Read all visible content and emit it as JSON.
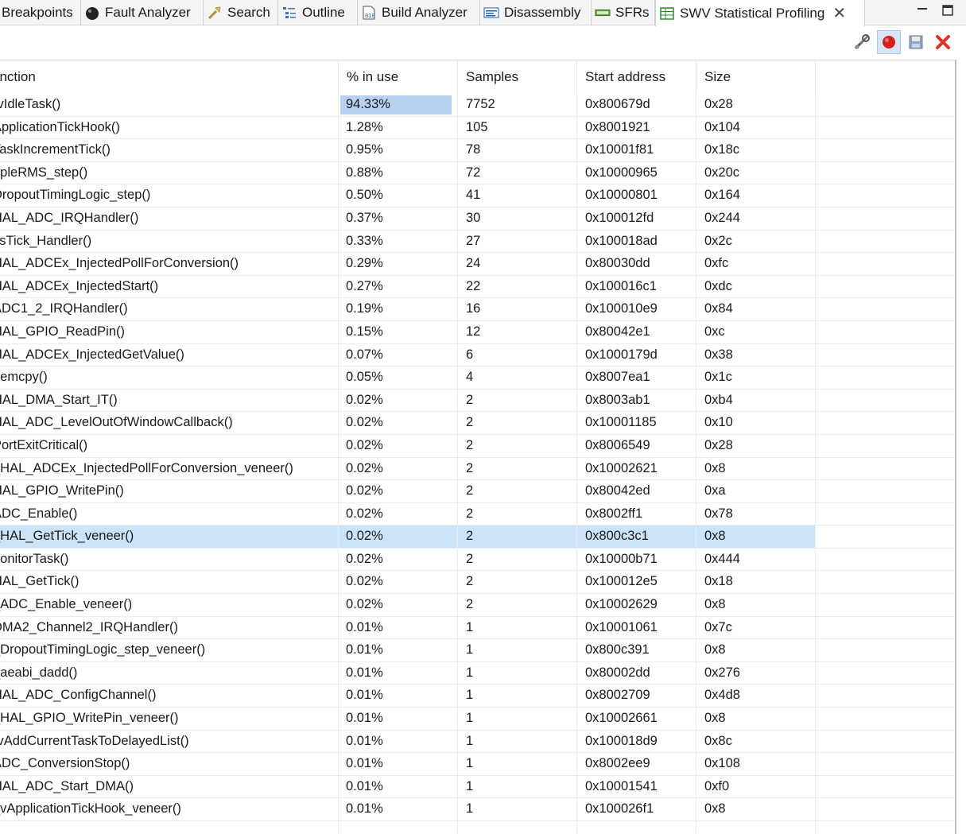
{
  "tabs": [
    {
      "label": "Breakpoints",
      "icon": "breakpoints-icon"
    },
    {
      "label": "Fault Analyzer",
      "icon": "fault-analyzer-icon"
    },
    {
      "label": "Search",
      "icon": "search-icon"
    },
    {
      "label": "Outline",
      "icon": "outline-icon"
    },
    {
      "label": "Build Analyzer",
      "icon": "build-analyzer-icon"
    },
    {
      "label": "Disassembly",
      "icon": "disassembly-icon"
    },
    {
      "label": "SFRs",
      "icon": "sfr-icon"
    },
    {
      "label": "SWV Statistical Profiling",
      "icon": "table-icon",
      "active": true
    }
  ],
  "window_controls": [
    "minimize-icon",
    "maximize-icon"
  ],
  "toolbar": [
    "configure-trace-icon",
    "record-icon",
    "save-icon",
    "remove-icon"
  ],
  "colors": {
    "selected_row": "#cce4f7",
    "usage_bar": "#b7d1ef",
    "record_red": "#d41f1f",
    "remove_red": "#e0302b"
  },
  "table": {
    "columns": [
      "unction",
      "% in use",
      "Samples",
      "Start address",
      "Size"
    ],
    "selected_row_index": 19,
    "rows": [
      {
        "function": "rvIdleTask()",
        "pct": "94.33%",
        "usage": 0.9433,
        "samples": "7752",
        "start": "0x800679d",
        "size": "0x28"
      },
      {
        "function": "ApplicationTickHook()",
        "pct": "1.28%",
        "usage": 0.0128,
        "samples": "105",
        "start": "0x8001921",
        "size": "0x104"
      },
      {
        "function": "TaskIncrementTick()",
        "pct": "0.95%",
        "usage": 0.0095,
        "samples": "78",
        "start": "0x10001f81",
        "size": "0x18c"
      },
      {
        "function": "ppleRMS_step()",
        "pct": "0.88%",
        "usage": 0.0088,
        "samples": "72",
        "start": "0x10000965",
        "size": "0x20c"
      },
      {
        "function": "DropoutTimingLogic_step()",
        "pct": "0.50%",
        "usage": 0.005,
        "samples": "41",
        "start": "0x10000801",
        "size": "0x164"
      },
      {
        "function": "HAL_ADC_IRQHandler()",
        "pct": "0.37%",
        "usage": 0.0037,
        "samples": "30",
        "start": "0x100012fd",
        "size": "0x244"
      },
      {
        "function": "ysTick_Handler()",
        "pct": "0.33%",
        "usage": 0.0033,
        "samples": "27",
        "start": "0x100018ad",
        "size": "0x2c"
      },
      {
        "function": "HAL_ADCEx_InjectedPollForConversion()",
        "pct": "0.29%",
        "usage": 0.0029,
        "samples": "24",
        "start": "0x80030dd",
        "size": "0xfc"
      },
      {
        "function": "HAL_ADCEx_InjectedStart()",
        "pct": "0.27%",
        "usage": 0.0027,
        "samples": "22",
        "start": "0x100016c1",
        "size": "0xdc"
      },
      {
        "function": "ADC1_2_IRQHandler()",
        "pct": "0.19%",
        "usage": 0.0019,
        "samples": "16",
        "start": "0x100010e9",
        "size": "0x84"
      },
      {
        "function": "HAL_GPIO_ReadPin()",
        "pct": "0.15%",
        "usage": 0.0015,
        "samples": "12",
        "start": "0x80042e1",
        "size": "0xc"
      },
      {
        "function": "HAL_ADCEx_InjectedGetValue()",
        "pct": "0.07%",
        "usage": 0.0007,
        "samples": "6",
        "start": "0x1000179d",
        "size": "0x38"
      },
      {
        "function": "nemcpy()",
        "pct": "0.05%",
        "usage": 0.0005,
        "samples": "4",
        "start": "0x8007ea1",
        "size": "0x1c"
      },
      {
        "function": "HAL_DMA_Start_IT()",
        "pct": "0.02%",
        "usage": 0.0002,
        "samples": "2",
        "start": "0x8003ab1",
        "size": "0xb4"
      },
      {
        "function": "HAL_ADC_LevelOutOfWindowCallback()",
        "pct": "0.02%",
        "usage": 0.0002,
        "samples": "2",
        "start": "0x10001185",
        "size": "0x10"
      },
      {
        "function": "PortExitCritical()",
        "pct": "0.02%",
        "usage": 0.0002,
        "samples": "2",
        "start": "0x8006549",
        "size": "0x28"
      },
      {
        "function": "_HAL_ADCEx_InjectedPollForConversion_veneer()",
        "pct": "0.02%",
        "usage": 0.0002,
        "samples": "2",
        "start": "0x10002621",
        "size": "0x8"
      },
      {
        "function": "HAL_GPIO_WritePin()",
        "pct": "0.02%",
        "usage": 0.0002,
        "samples": "2",
        "start": "0x80042ed",
        "size": "0xa"
      },
      {
        "function": "ADC_Enable()",
        "pct": "0.02%",
        "usage": 0.0002,
        "samples": "2",
        "start": "0x8002ff1",
        "size": "0x78"
      },
      {
        "function": "_HAL_GetTick_veneer()",
        "pct": "0.02%",
        "usage": 0.0002,
        "samples": "2",
        "start": "0x800c3c1",
        "size": "0x8"
      },
      {
        "function": "nonitorTask()",
        "pct": "0.02%",
        "usage": 0.0002,
        "samples": "2",
        "start": "0x10000b71",
        "size": "0x444"
      },
      {
        "function": "HAL_GetTick()",
        "pct": "0.02%",
        "usage": 0.0002,
        "samples": "2",
        "start": "0x100012e5",
        "size": "0x18"
      },
      {
        "function": "_ADC_Enable_veneer()",
        "pct": "0.02%",
        "usage": 0.0002,
        "samples": "2",
        "start": "0x10002629",
        "size": "0x8"
      },
      {
        "function": "DMA2_Channel2_IRQHandler()",
        "pct": "0.01%",
        "usage": 0.0001,
        "samples": "1",
        "start": "0x10001061",
        "size": "0x7c"
      },
      {
        "function": "_DropoutTimingLogic_step_veneer()",
        "pct": "0.01%",
        "usage": 0.0001,
        "samples": "1",
        "start": "0x800c391",
        "size": "0x8"
      },
      {
        "function": "_aeabi_dadd()",
        "pct": "0.01%",
        "usage": 0.0001,
        "samples": "1",
        "start": "0x80002dd",
        "size": "0x276"
      },
      {
        "function": "HAL_ADC_ConfigChannel()",
        "pct": "0.01%",
        "usage": 0.0001,
        "samples": "1",
        "start": "0x8002709",
        "size": "0x4d8"
      },
      {
        "function": "_HAL_GPIO_WritePin_veneer()",
        "pct": "0.01%",
        "usage": 0.0001,
        "samples": "1",
        "start": "0x10002661",
        "size": "0x8"
      },
      {
        "function": "rvAddCurrentTaskToDelayedList()",
        "pct": "0.01%",
        "usage": 0.0001,
        "samples": "1",
        "start": "0x100018d9",
        "size": "0x8c"
      },
      {
        "function": "ADC_ConversionStop()",
        "pct": "0.01%",
        "usage": 0.0001,
        "samples": "1",
        "start": "0x8002ee9",
        "size": "0x108"
      },
      {
        "function": "HAL_ADC_Start_DMA()",
        "pct": "0.01%",
        "usage": 0.0001,
        "samples": "1",
        "start": "0x10001541",
        "size": "0xf0"
      },
      {
        "function": "_vApplicationTickHook_veneer()",
        "pct": "0.01%",
        "usage": 0.0001,
        "samples": "1",
        "start": "0x100026f1",
        "size": "0x8"
      }
    ]
  }
}
